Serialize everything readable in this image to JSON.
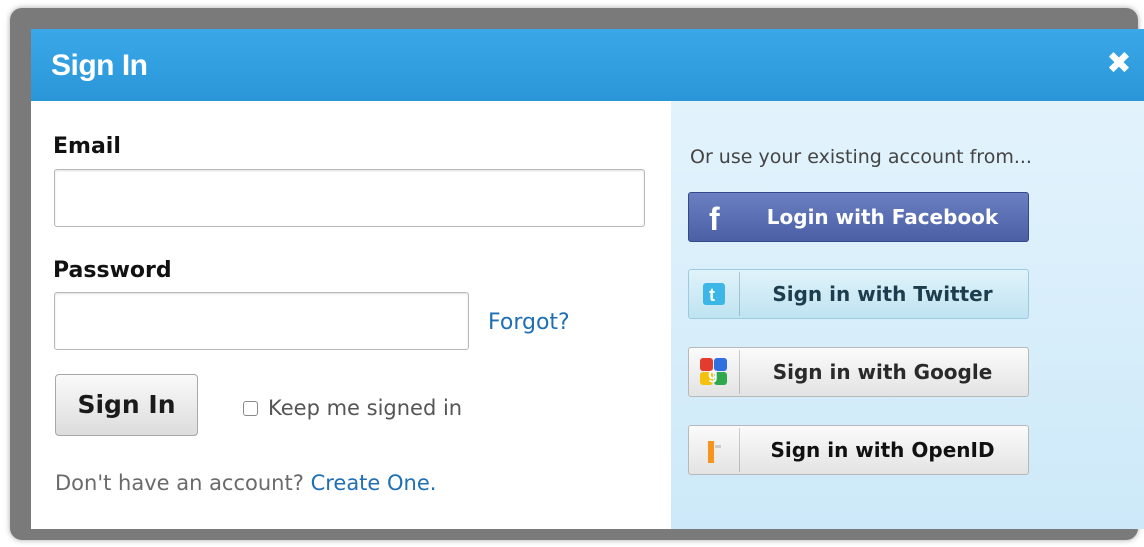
{
  "dialog": {
    "title": "Sign In",
    "close_symbol": "✖"
  },
  "form": {
    "email_label": "Email",
    "email_value": "",
    "password_label": "Password",
    "password_value": "",
    "forgot_link": "Forgot?",
    "signin_button": "Sign In",
    "keep_signed_in_label": "Keep me signed in",
    "keep_signed_in_checked": false,
    "no_account_text": "Don't have an account?",
    "create_link": "Create One."
  },
  "social": {
    "heading": "Or use your existing account from...",
    "buttons": [
      {
        "label": "Login with Facebook",
        "icon": "facebook-icon"
      },
      {
        "label": "Sign in with Twitter",
        "icon": "twitter-icon"
      },
      {
        "label": "Sign in with Google",
        "icon": "google-icon"
      },
      {
        "label": "Sign in with OpenID",
        "icon": "openid-icon"
      }
    ]
  },
  "colors": {
    "titlebar": "#2a96d8",
    "link": "#1f6fb5",
    "facebook": "#4a5fa5",
    "right_panel": "#cde9f9"
  }
}
